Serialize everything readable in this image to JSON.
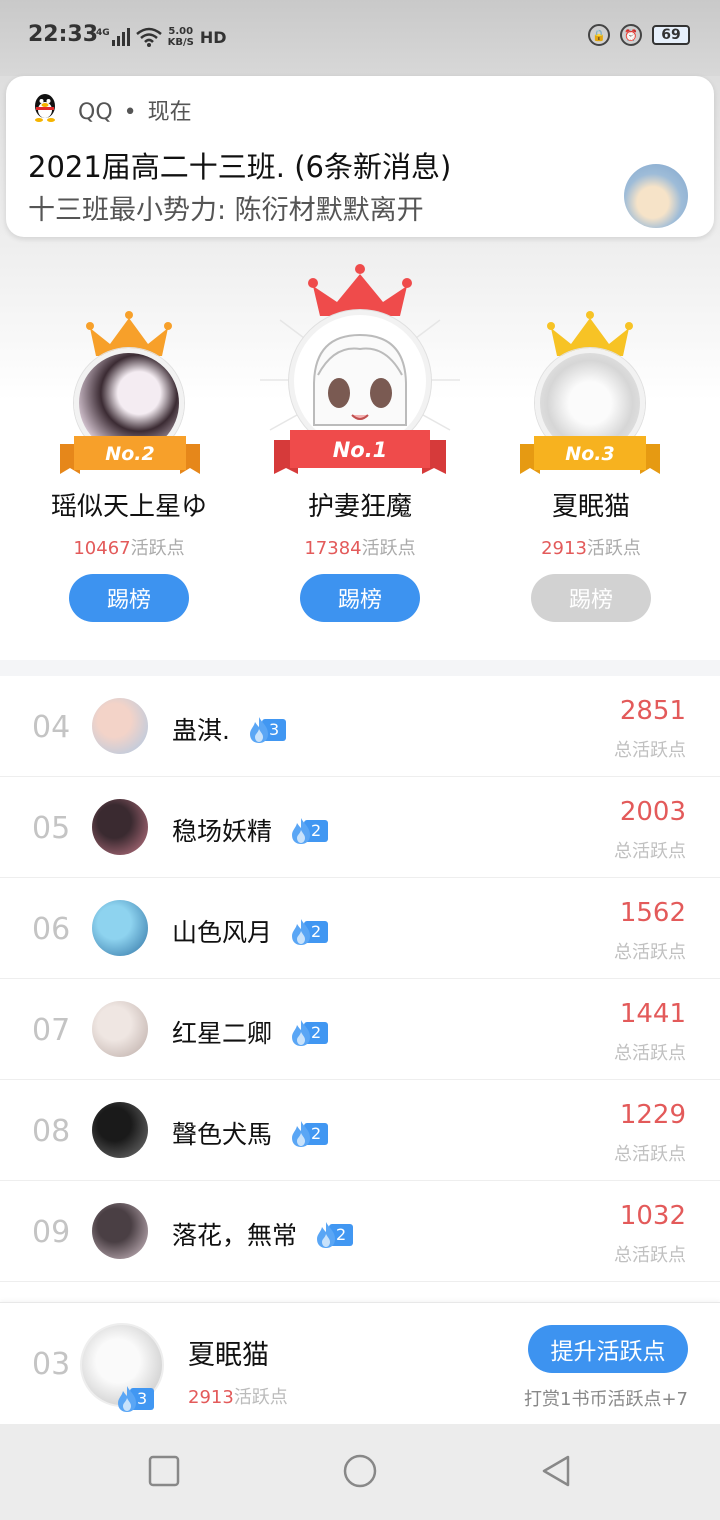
{
  "status_bar": {
    "time": "22:33",
    "network": "4G",
    "speed_value": "5.00",
    "speed_unit": "KB/S",
    "hd": "HD",
    "battery": "69"
  },
  "notification": {
    "app": "QQ",
    "separator": "•",
    "time": "现在",
    "title": "2021届高二十三班. (6条新消息)",
    "body": "十三班最小势力: 陈衍材默默离开"
  },
  "podium": [
    {
      "rank_label": "No.2",
      "name": "瑶似天上星ゆ",
      "points": "10467",
      "points_unit": "活跃点",
      "button": "踢榜",
      "button_enabled": true,
      "crown_color": "#f7a02a",
      "ribbon_color": "#f7a02a"
    },
    {
      "rank_label": "No.1",
      "name": "护妻狂魔",
      "points": "17384",
      "points_unit": "活跃点",
      "button": "踢榜",
      "button_enabled": true,
      "crown_color": "#ef4b4b",
      "ribbon_color": "#ef4b4b"
    },
    {
      "rank_label": "No.3",
      "name": "夏眠猫",
      "points": "2913",
      "points_unit": "活跃点",
      "button": "踢榜",
      "button_enabled": false,
      "crown_color": "#f7c325",
      "ribbon_color": "#f7b21f"
    }
  ],
  "list": [
    {
      "rank": "04",
      "name": "蛊淇.",
      "level": "3",
      "score": "2851",
      "label": "总活跃点",
      "avatar_colors": [
        "#f3d3c8",
        "#a9c8e6"
      ]
    },
    {
      "rank": "05",
      "name": "稳场妖精",
      "level": "2",
      "score": "2003",
      "label": "总活跃点",
      "avatar_colors": [
        "#3a2a30",
        "#c77a8a"
      ]
    },
    {
      "rank": "06",
      "name": "山色风月",
      "level": "2",
      "score": "1562",
      "label": "总活跃点",
      "avatar_colors": [
        "#8ed3ef",
        "#2d6fa1"
      ]
    },
    {
      "rank": "07",
      "name": "红星二卿",
      "level": "2",
      "score": "1441",
      "label": "总活跃点",
      "avatar_colors": [
        "#efe6e2",
        "#b9a9a4"
      ]
    },
    {
      "rank": "08",
      "name": "聲色犬馬",
      "level": "2",
      "score": "1229",
      "label": "总活跃点",
      "avatar_colors": [
        "#1a1a1a",
        "#777777"
      ]
    },
    {
      "rank": "09",
      "name": "落花，無常",
      "level": "2",
      "score": "1032",
      "label": "总活跃点",
      "avatar_colors": [
        "#4a3f44",
        "#d9c7cf"
      ]
    }
  ],
  "my_card": {
    "rank": "03",
    "name": "夏眠猫",
    "level": "3",
    "points": "2913",
    "points_unit": "活跃点",
    "boost_button": "提升活跃点",
    "reward_text": "打赏1书币活跃点+7"
  },
  "icons": {
    "qq": "qq-penguin-icon",
    "flame": "flame-icon",
    "crown": "crown-icon",
    "nav_recent": "square-icon",
    "nav_home": "circle-icon",
    "nav_back": "triangle-back-icon"
  },
  "colors": {
    "accent_blue": "#3d93f0",
    "score_red": "#e35a5a",
    "disabled_gray": "#d2d2d2"
  }
}
